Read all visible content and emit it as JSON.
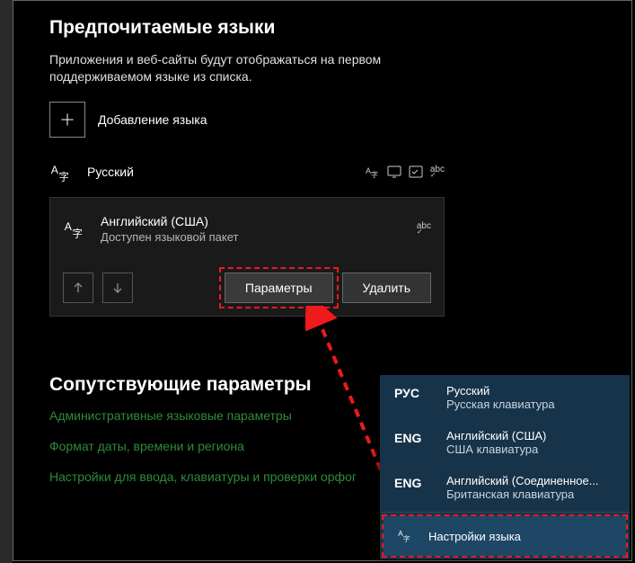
{
  "preferred": {
    "title": "Предпочитаемые языки",
    "desc": "Приложения и веб-сайты будут отображаться на первом поддерживаемом языке из списка.",
    "add_label": "Добавление языка"
  },
  "languages": [
    {
      "name": "Русский"
    },
    {
      "name": "Английский (США)",
      "sub": "Доступен языковой пакет"
    }
  ],
  "card_actions": {
    "options": "Параметры",
    "remove": "Удалить"
  },
  "related": {
    "title": "Сопутствующие параметры",
    "links": [
      "Административные языковые параметры",
      "Формат даты, времени и региона",
      "Настройки для ввода, клавиатуры и проверки орфог"
    ]
  },
  "flyout": {
    "items": [
      {
        "code": "РУС",
        "main": "Русский",
        "sub": "Русская клавиатура"
      },
      {
        "code": "ENG",
        "main": "Английский (США)",
        "sub": "США клавиатура"
      },
      {
        "code": "ENG",
        "main": "Английский (Соединенное...",
        "sub": "Британская клавиатура"
      }
    ],
    "settings": "Настройки языка"
  }
}
